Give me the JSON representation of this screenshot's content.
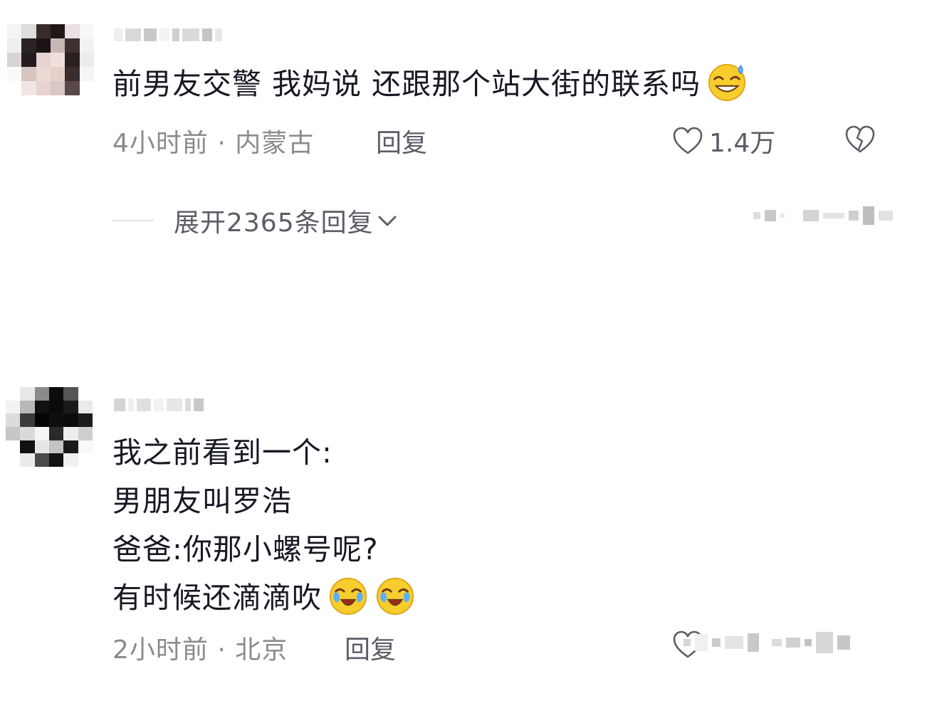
{
  "comments": [
    {
      "text": "前男友交警 我妈说 还跟那个站大街的联系吗",
      "emoji": "sweat-grin-emoji",
      "time": "4小时前",
      "location": "内蒙古",
      "reply_label": "回复",
      "likes": "1.4万",
      "expand_label": "展开2365条回复"
    },
    {
      "lines": [
        "我之前看到一个:",
        "男朋友叫罗浩",
        "爸爸:你那小螺号呢?",
        "有时候还滴滴吹"
      ],
      "emoji": "laugh-cry-emoji",
      "time": "2小时前",
      "location": "北京",
      "reply_label": "回复"
    }
  ],
  "colors": {
    "text": "#161823",
    "meta": "#8a8b91",
    "action": "#5b5d66",
    "emoji_yellow": "#f7cd2e"
  }
}
